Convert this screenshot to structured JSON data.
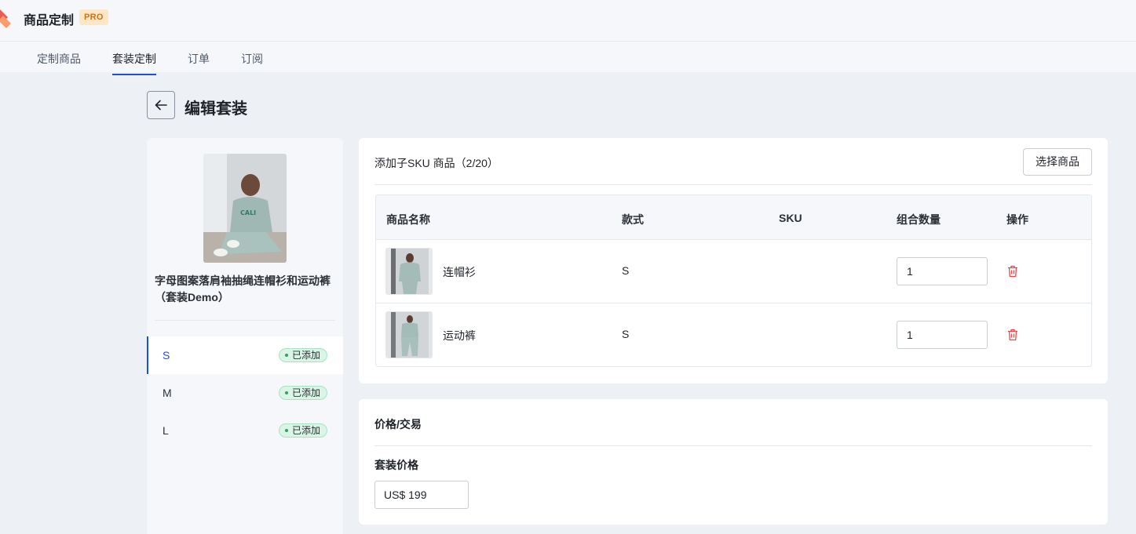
{
  "header": {
    "app_title": "商品定制",
    "pro_badge": "PRO"
  },
  "tabs": [
    {
      "label": "定制商品"
    },
    {
      "label": "套装定制",
      "active": true
    },
    {
      "label": "订单"
    },
    {
      "label": "订阅"
    }
  ],
  "page": {
    "title": "编辑套装"
  },
  "product": {
    "name": "字母图案落肩袖抽绳连帽衫和运动裤（套装Demo）",
    "variants": [
      {
        "label": "S",
        "status": "已添加",
        "active": true
      },
      {
        "label": "M",
        "status": "已添加"
      },
      {
        "label": "L",
        "status": "已添加"
      }
    ]
  },
  "sku_section": {
    "title": "添加子SKU 商品（2/20）",
    "select_button": "选择商品",
    "columns": [
      "商品名称",
      "款式",
      "SKU",
      "组合数量",
      "操作"
    ],
    "rows": [
      {
        "name": "连帽衫",
        "style": "S",
        "sku": "",
        "quantity": "1"
      },
      {
        "name": "运动裤",
        "style": "S",
        "sku": "",
        "quantity": "1"
      }
    ]
  },
  "price_section": {
    "title": "价格/交易",
    "label": "套装价格",
    "value": "US$ 199"
  },
  "colors": {
    "accent": "#1d4fd8",
    "danger": "#e5484d",
    "status_green": "#2aa564"
  },
  "icons": {
    "back": "arrow-left-icon",
    "delete": "trash-icon",
    "logo": "brand-logo"
  }
}
